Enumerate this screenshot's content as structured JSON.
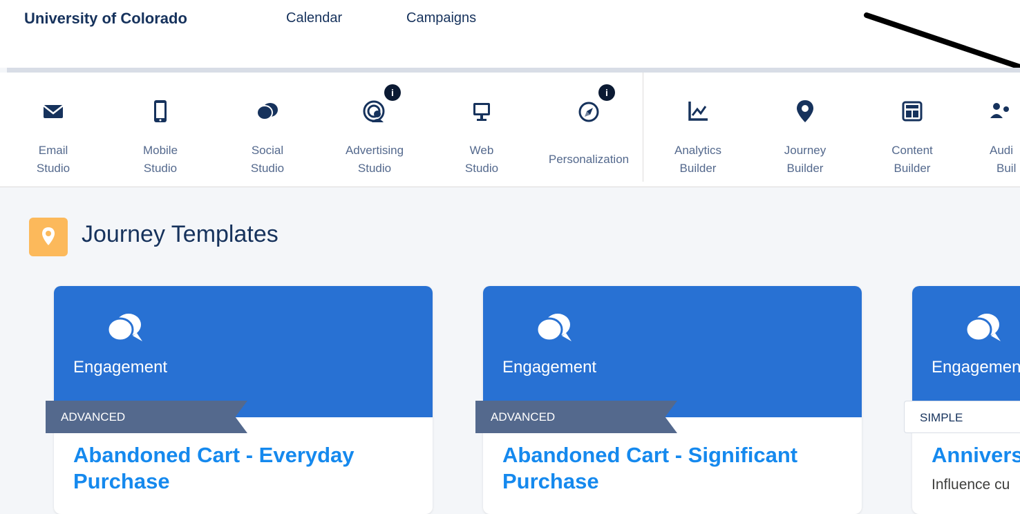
{
  "header": {
    "org_name": "University of Colorado",
    "links": [
      "Calendar",
      "Campaigns"
    ]
  },
  "apps": [
    {
      "line1": "Email",
      "line2": "Studio",
      "icon": "envelope-icon"
    },
    {
      "line1": "Mobile",
      "line2": "Studio",
      "icon": "mobile-phone-icon"
    },
    {
      "line1": "Social",
      "line2": "Studio",
      "icon": "chat-bubbles-icon"
    },
    {
      "line1": "Advertising",
      "line2": "Studio",
      "icon": "advertising-target-icon",
      "badge": "i"
    },
    {
      "line1": "Web",
      "line2": "Studio",
      "icon": "monitor-icon"
    },
    {
      "line1": "Personalization",
      "line2": "",
      "icon": "compass-icon",
      "badge": "i"
    },
    {
      "line1": "Analytics",
      "line2": "Builder",
      "icon": "line-chart-icon"
    },
    {
      "line1": "Journey",
      "line2": "Builder",
      "icon": "map-pin-icon"
    },
    {
      "line1": "Content",
      "line2": "Builder",
      "icon": "layout-grid-icon"
    },
    {
      "line1": "Audi",
      "line2": "Buil",
      "icon": "audience-icon"
    }
  ],
  "section": {
    "title": "Journey Templates",
    "icon": "location-pin-icon"
  },
  "cards": [
    {
      "category": "Engagement",
      "level": "ADVANCED",
      "title": "Abandoned Cart - Everyday Purchase",
      "description": ""
    },
    {
      "category": "Engagement",
      "level": "ADVANCED",
      "title": "Abandoned Cart - Significant Purchase",
      "description": ""
    },
    {
      "category": "Engagemen",
      "level": "SIMPLE",
      "title": "Annivers",
      "description": "Influence cu"
    }
  ],
  "colors": {
    "brand_blue": "#2871d3",
    "title_blue": "#1589ee",
    "navy": "#16325c",
    "section_icon_bg": "#fcb95b"
  }
}
